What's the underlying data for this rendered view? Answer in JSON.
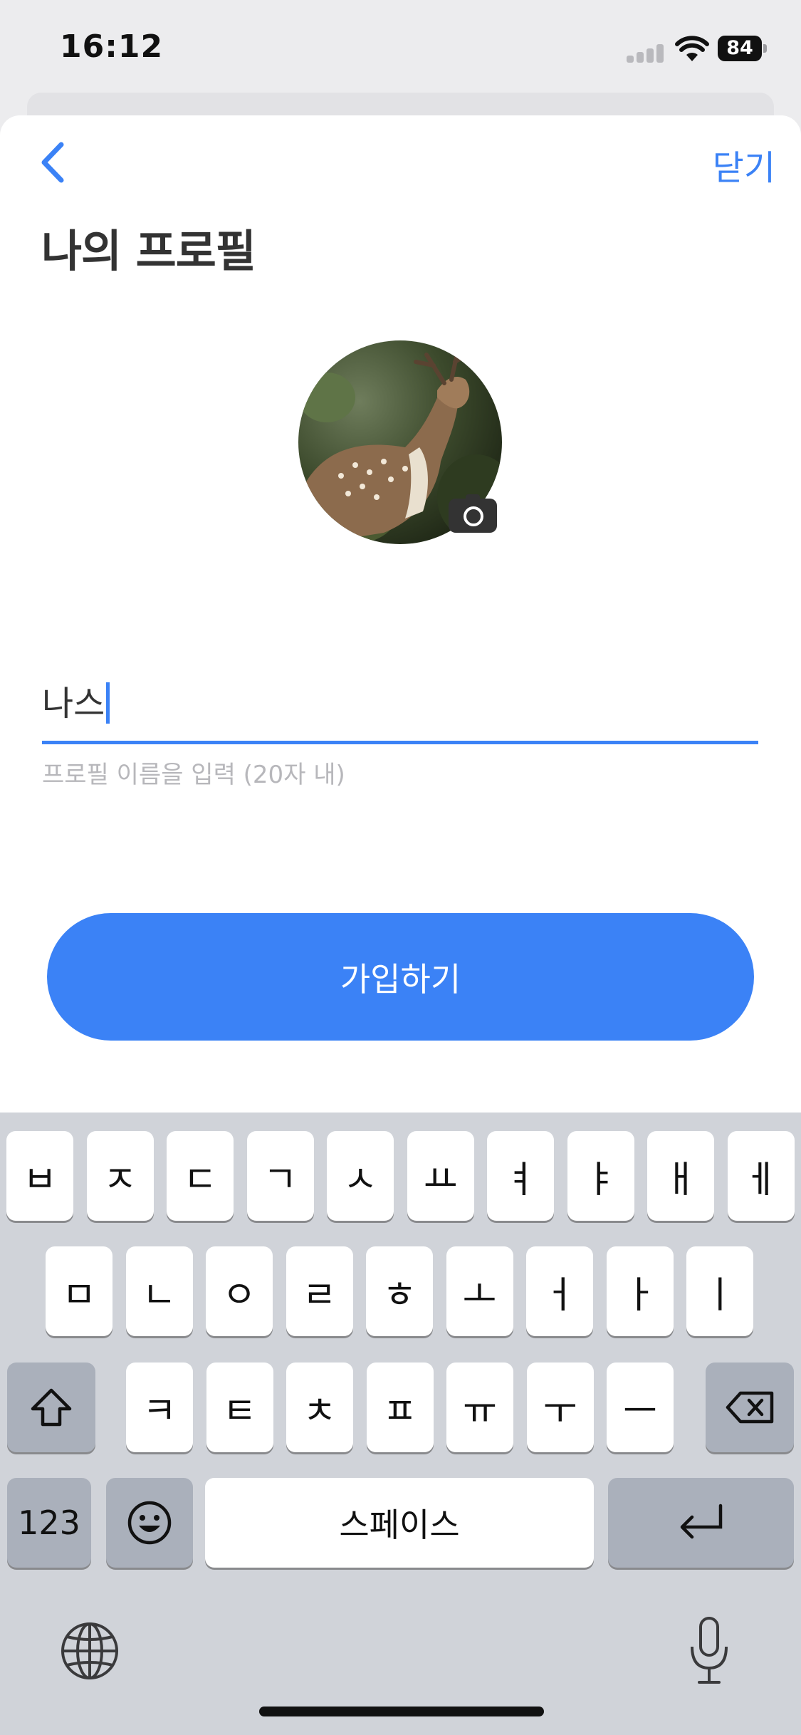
{
  "status_bar": {
    "time": "16:12",
    "battery": "84"
  },
  "header": {
    "close_label": "닫기",
    "title": "나의 프로필"
  },
  "profile": {
    "avatar_description": "deer-photo"
  },
  "name_field": {
    "value": "나스",
    "helper": "프로필 이름을 입력 (20자 내)"
  },
  "submit": {
    "label": "가입하기"
  },
  "keyboard": {
    "row1": [
      "ㅂ",
      "ㅈ",
      "ㄷ",
      "ㄱ",
      "ㅅ",
      "ㅛ",
      "ㅕ",
      "ㅑ",
      "ㅐ",
      "ㅔ"
    ],
    "row2": [
      "ㅁ",
      "ㄴ",
      "ㅇ",
      "ㄹ",
      "ㅎ",
      "ㅗ",
      "ㅓ",
      "ㅏ",
      "ㅣ"
    ],
    "row3": [
      "ㅋ",
      "ㅌ",
      "ㅊ",
      "ㅍ",
      "ㅠ",
      "ㅜ",
      "ㅡ"
    ],
    "numbers_label": "123",
    "space_label": "스페이스"
  },
  "colors": {
    "accent": "#3b82f6",
    "keyboard_bg": "#d0d3d9",
    "dark_key": "#aab0bb"
  }
}
